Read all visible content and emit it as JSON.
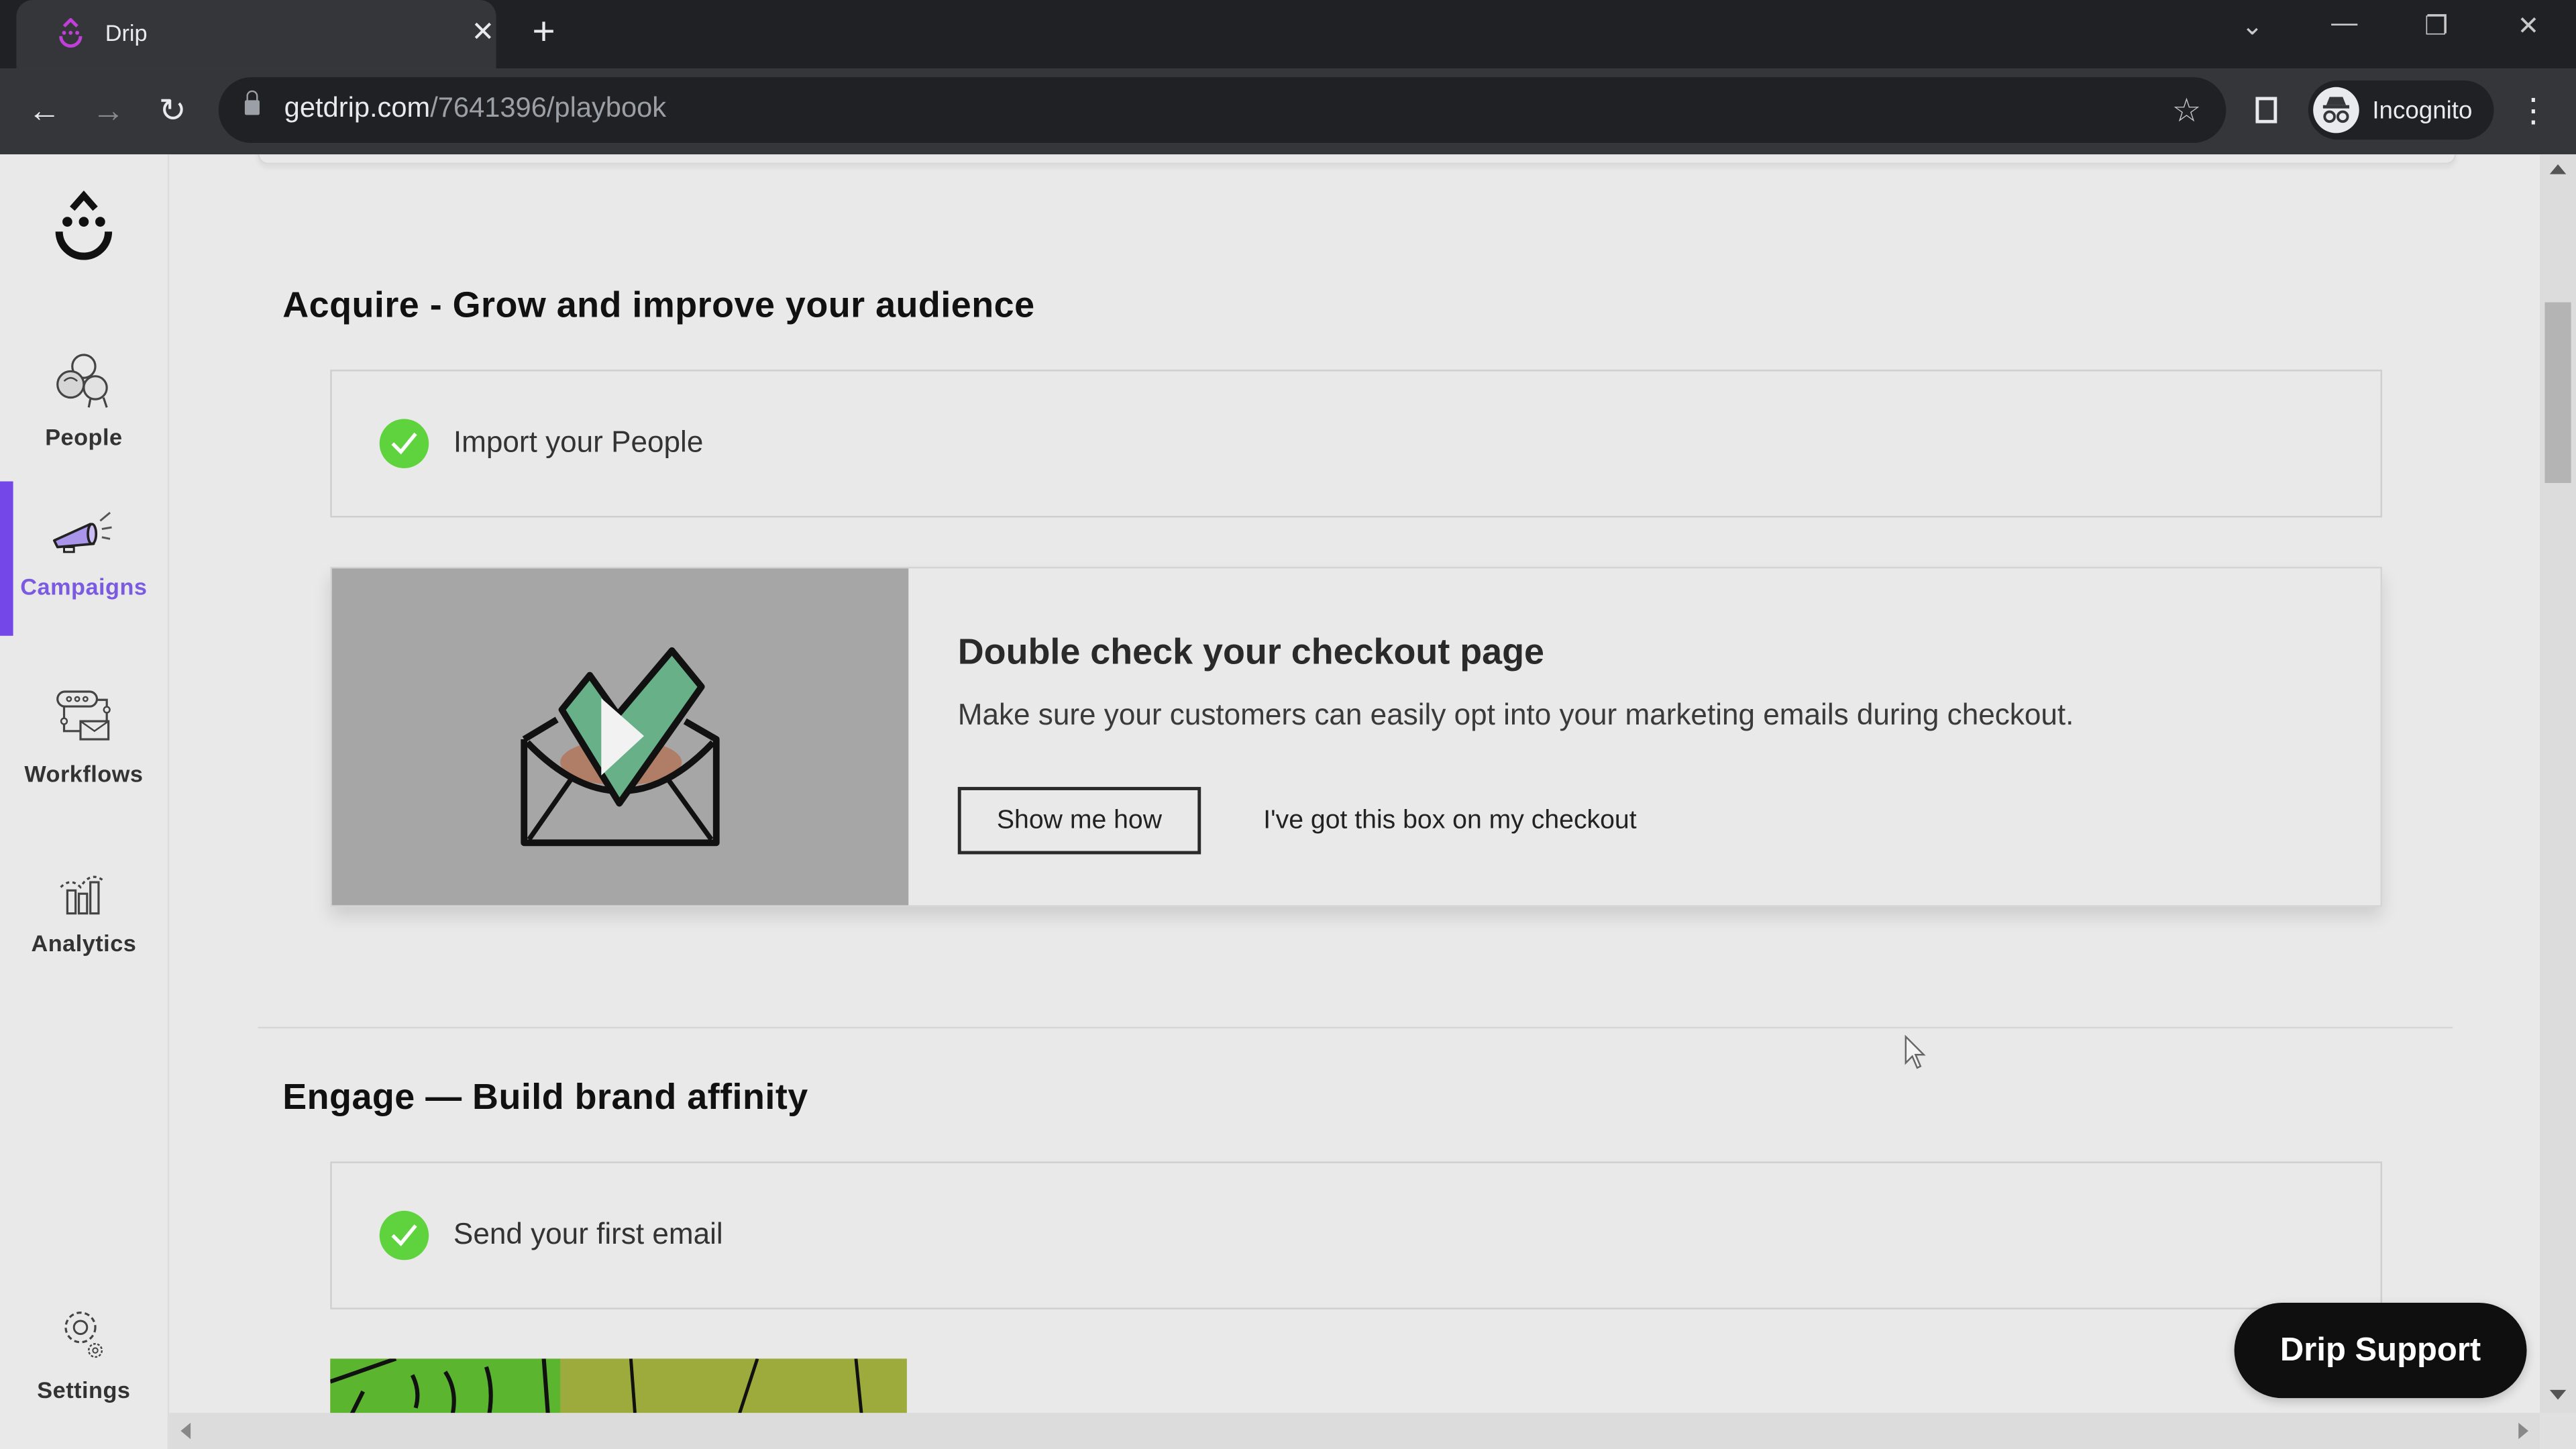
{
  "browser": {
    "tab": {
      "title": "Drip",
      "favicon": "drip-logo-icon",
      "close_icon": "close-icon"
    },
    "new_tab_icon": "plus-icon",
    "window_controls": {
      "tab_search": "chevron-down-icon",
      "minimize": "minimize-icon",
      "restore": "restore-icon",
      "close": "close-icon"
    },
    "nav": {
      "back": "arrow-left-icon",
      "forward": "arrow-right-icon",
      "reload": "reload-icon"
    },
    "address": {
      "domain": "getdrip.com",
      "path": "/7641396/playbook",
      "lock_icon": "lock-icon"
    },
    "bookmark_icon": "star-icon",
    "side_panel_icon": "side-panel-icon",
    "profile": {
      "label": "Incognito",
      "icon": "incognito-icon"
    },
    "menu_icon": "kebab-menu-icon"
  },
  "sidebar": {
    "logo": "drip-logo-icon",
    "items": [
      {
        "label": "People",
        "icon": "people-icon",
        "active": false
      },
      {
        "label": "Campaigns",
        "icon": "megaphone-icon",
        "active": true
      },
      {
        "label": "Workflows",
        "icon": "workflow-icon",
        "active": false
      },
      {
        "label": "Analytics",
        "icon": "analytics-icon",
        "active": false
      },
      {
        "label": "Settings",
        "icon": "gear-icon",
        "active": false
      }
    ],
    "accent_color": "#7448e8"
  },
  "main": {
    "sections": [
      {
        "title": "Acquire - Grow and improve your audience",
        "tasks": [
          {
            "label": "Import your People",
            "status": "completed"
          }
        ],
        "feature": {
          "title": "Double check your checkout page",
          "description": "Make sure your customers can easily opt into your marketing emails during checkout.",
          "primary_action": "Show me how",
          "secondary_action": "I've got this box on my checkout",
          "media": "video-thumbnail-envelope-checkmark"
        }
      },
      {
        "title": "Engage — Build brand affinity",
        "tasks": [
          {
            "label": "Send your first email",
            "status": "completed"
          }
        ]
      }
    ],
    "completed_color": "#5fd33e"
  },
  "support_button": {
    "label": "Drip Support"
  }
}
